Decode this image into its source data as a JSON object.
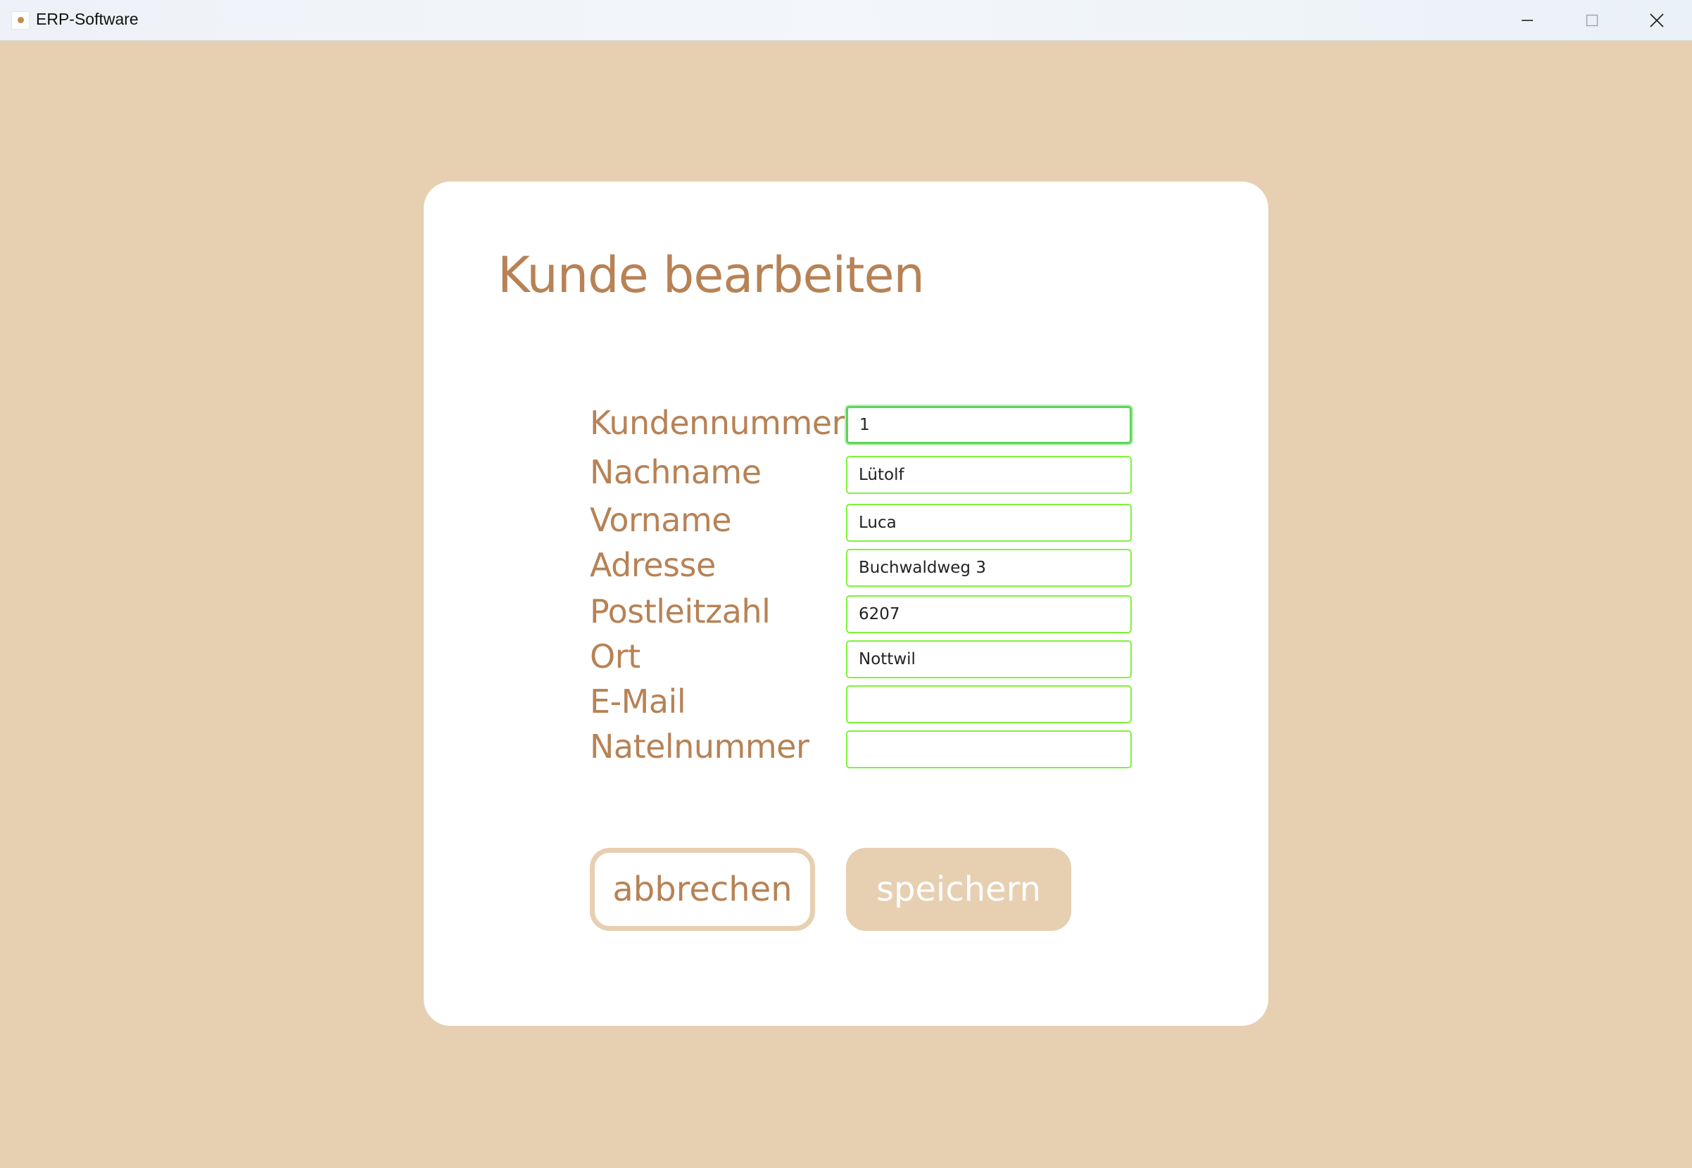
{
  "window": {
    "title": "ERP-Software",
    "icon": "app-logo-icon",
    "controls": [
      "minimize-icon",
      "maximize-icon",
      "close-icon"
    ]
  },
  "dialog": {
    "title": "Kunde bearbeiten",
    "fields": [
      {
        "label": "Kundennummer",
        "value": "1",
        "focused": true
      },
      {
        "label": "Nachname",
        "value": "Lütolf"
      },
      {
        "label": "Vorname",
        "value": "Luca"
      },
      {
        "label": "Adresse",
        "value": "Buchwaldweg 3"
      },
      {
        "label": "Postleitzahl",
        "value": "6207"
      },
      {
        "label": "Ort",
        "value": "Nottwil"
      },
      {
        "label": "E-Mail",
        "value": ""
      },
      {
        "label": "Natelnummer",
        "value": ""
      }
    ],
    "buttons": {
      "cancel": "abbrechen",
      "save": "speichern"
    }
  },
  "colors": {
    "background": "#e7cfb1",
    "accent_text": "#b78255",
    "field_border": "#7ff23a",
    "card": "#ffffff"
  }
}
